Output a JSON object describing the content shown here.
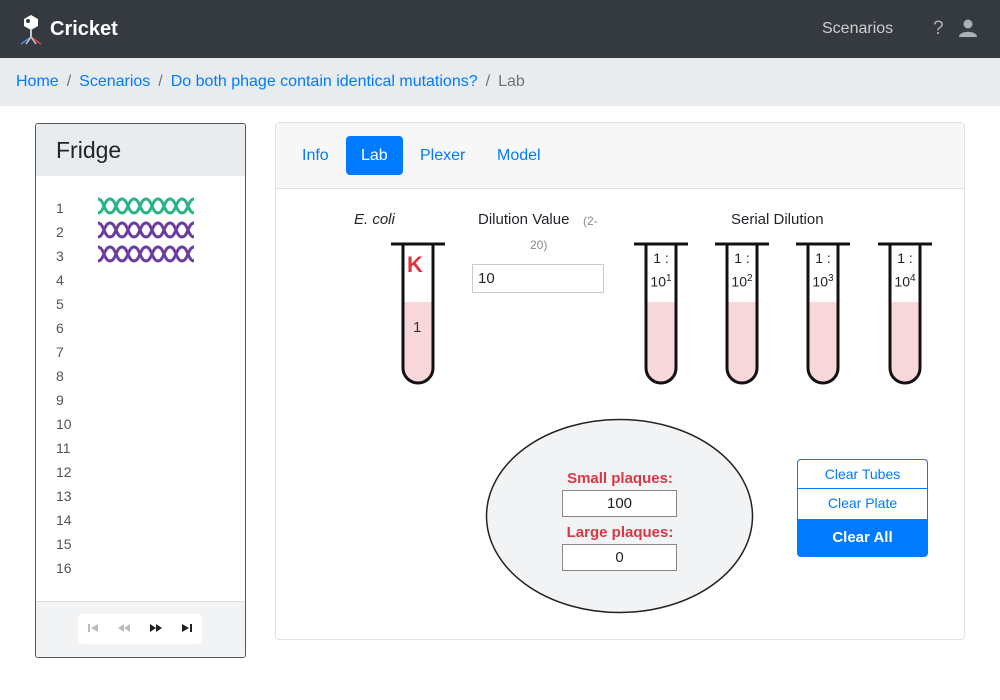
{
  "app": {
    "brand": "Cricket",
    "nav_scenarios": "Scenarios",
    "help": "?"
  },
  "breadcrumb": {
    "home": "Home",
    "scenarios": "Scenarios",
    "scenario": "Do both phage contain identical mutations?",
    "current": "Lab",
    "sep": "/"
  },
  "fridge": {
    "title": "Fridge",
    "slots": [
      "1",
      "2",
      "3",
      "4",
      "5",
      "6",
      "7",
      "8",
      "9",
      "10",
      "11",
      "12",
      "13",
      "14",
      "15",
      "16"
    ],
    "phage_colors": [
      "#2bb38a",
      "#6a3fa0",
      "#6a3fa0"
    ]
  },
  "tabs": [
    "Info",
    "Lab",
    "Plexer",
    "Model"
  ],
  "lab": {
    "ecoli_label": "E. coli",
    "ecoli_strain": "K",
    "ecoli_tube_num": "1",
    "dilution_label": "Dilution Value",
    "dilution_range_a": "(2-",
    "dilution_range_b": "20)",
    "dilution_value": "10",
    "serial_label": "Serial Dilution",
    "tubes": [
      {
        "ratio": "1 :",
        "base": "10",
        "exp": "1"
      },
      {
        "ratio": "1 :",
        "base": "10",
        "exp": "2"
      },
      {
        "ratio": "1 :",
        "base": "10",
        "exp": "3"
      },
      {
        "ratio": "1 :",
        "base": "10",
        "exp": "4"
      }
    ],
    "small_plaques_label": "Small plaques:",
    "small_plaques_value": "100",
    "large_plaques_label": "Large plaques:",
    "large_plaques_value": "0"
  },
  "buttons": {
    "clear_tubes": "Clear Tubes",
    "clear_plate": "Clear Plate",
    "clear_all": "Clear All"
  },
  "colors": {
    "navbar": "#343a40",
    "accent": "#007bff",
    "liquid": "#f8d7da",
    "danger": "#dc3545"
  }
}
